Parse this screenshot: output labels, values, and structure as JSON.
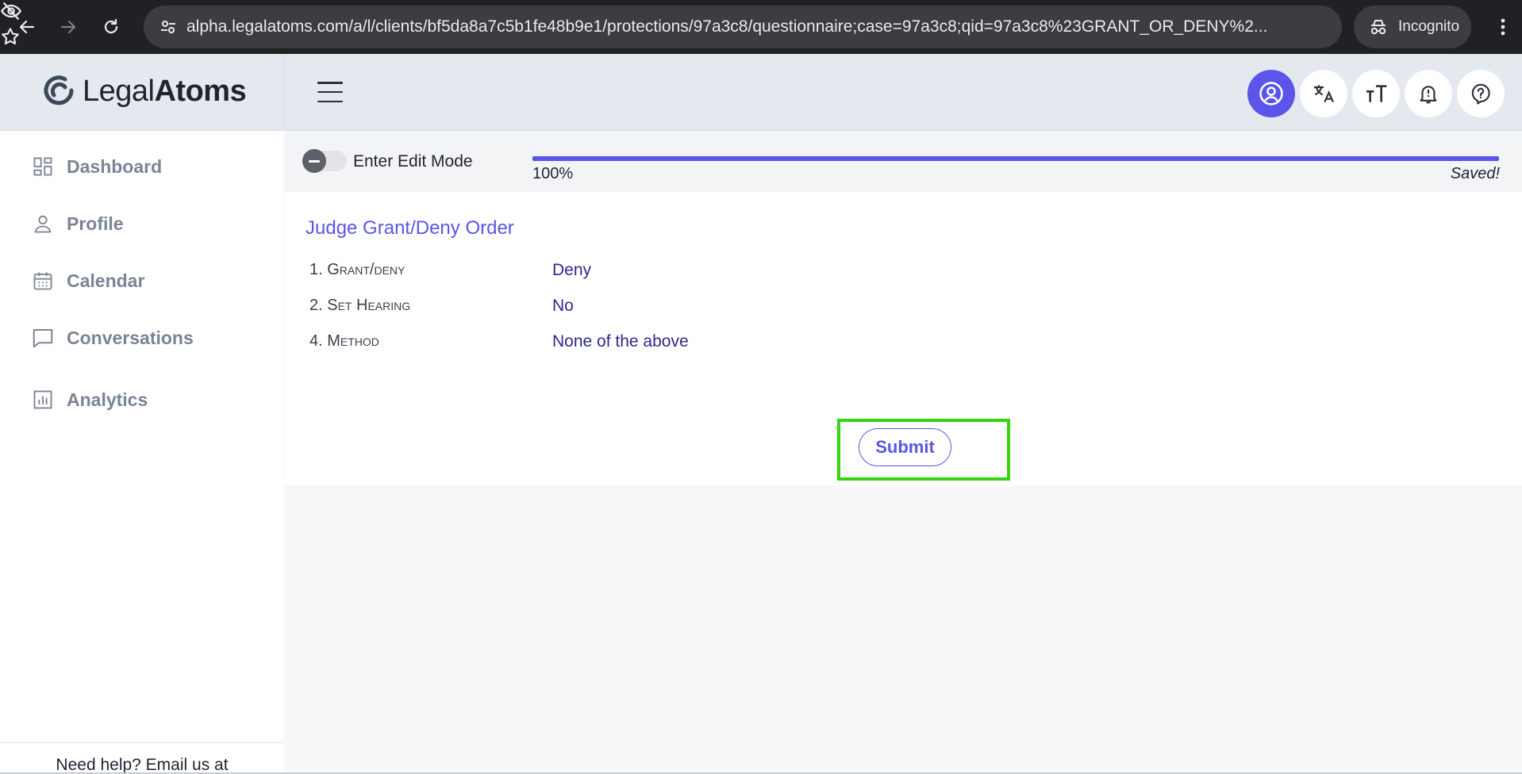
{
  "browser": {
    "url": "alpha.legalatoms.com/a/l/clients/bf5da8a7c5b1fe48b9e1/protections/97a3c8/questionnaire;case=97a3c8;qid=97a3c8%23GRANT_OR_DENY%2...",
    "mode_label": "Incognito"
  },
  "app": {
    "logo_light": "Legal",
    "logo_bold": "Atoms",
    "accent_color": "#5b55ea"
  },
  "sidebar": {
    "items": [
      {
        "label": "Dashboard",
        "icon": "dashboard-grid-icon"
      },
      {
        "label": "Profile",
        "icon": "person-icon"
      },
      {
        "label": "Calendar",
        "icon": "calendar-icon"
      },
      {
        "label": "Conversations",
        "icon": "chat-bubble-icon"
      },
      {
        "label": "Analytics",
        "icon": "bar-chart-icon"
      }
    ],
    "footer": "Need help? Email us at"
  },
  "topbar": {
    "edit_mode_label": "Enter Edit Mode",
    "progress_percent": 100,
    "progress_label": "100%",
    "save_status": "Saved!"
  },
  "questionnaire": {
    "title": "Judge Grant/Deny Order",
    "answers": [
      {
        "question": "1. Grant/deny",
        "answer": "Deny"
      },
      {
        "question": "2. Set Hearing",
        "answer": "No"
      },
      {
        "question": "4. Method",
        "answer": "None of the above"
      }
    ],
    "submit_label": "Submit"
  }
}
